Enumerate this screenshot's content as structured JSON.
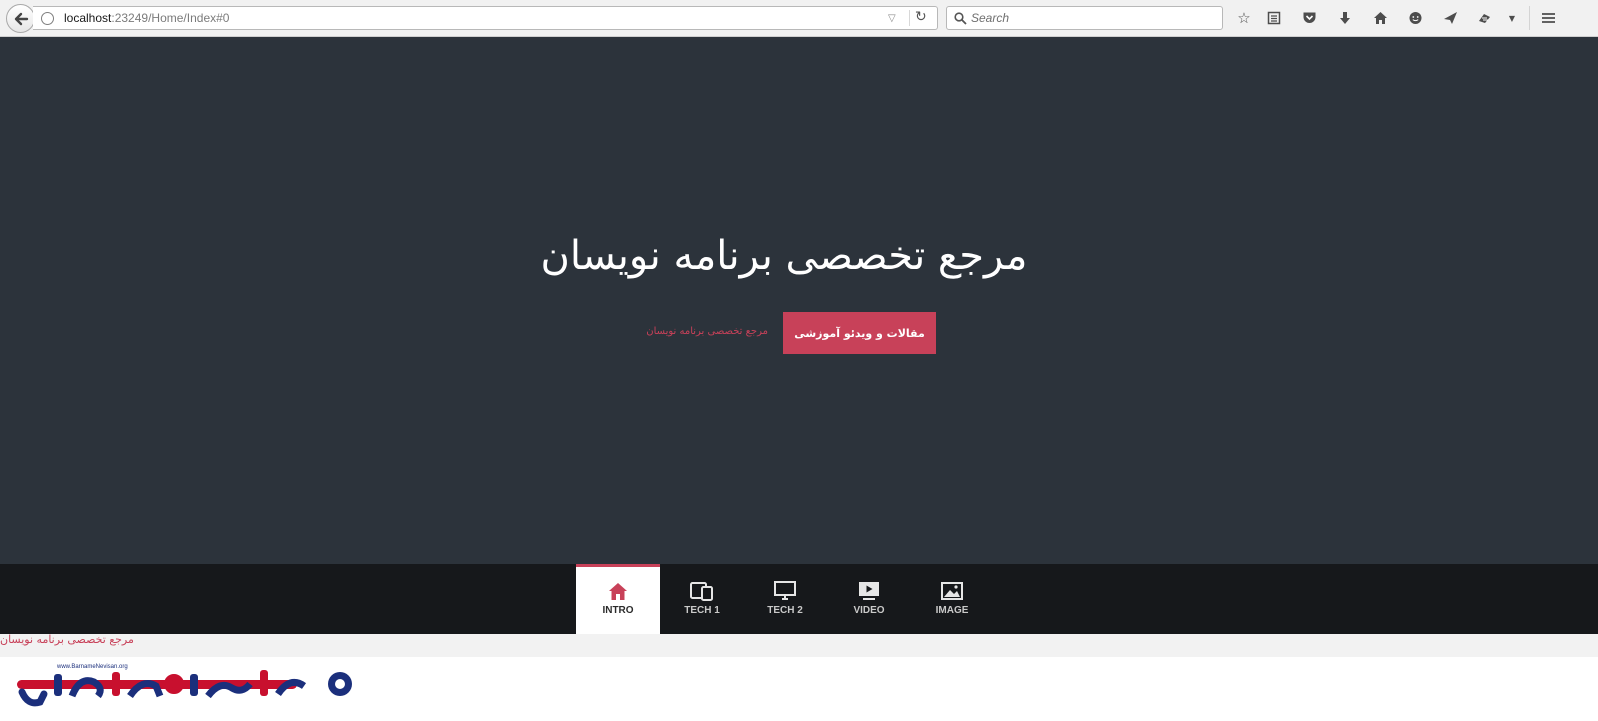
{
  "browser": {
    "url_host": "localhost",
    "url_rest": ":23249/Home/Index#0",
    "search_placeholder": "Search"
  },
  "hero": {
    "title": "مرجع تخصصی برنامه نویسان",
    "cta_label": "مقالات و ویدئو آموزشی",
    "link_text": "مرجع تخصصی برنامه نویسان"
  },
  "nav": {
    "items": [
      {
        "label": "INTRO",
        "icon": "home-icon",
        "active": true
      },
      {
        "label": "TECH 1",
        "icon": "devices-icon",
        "active": false
      },
      {
        "label": "TECH 2",
        "icon": "monitor-icon",
        "active": false
      },
      {
        "label": "VIDEO",
        "icon": "video-icon",
        "active": false
      },
      {
        "label": "IMAGE",
        "icon": "image-icon",
        "active": false
      }
    ]
  },
  "footer": {
    "text": "مرجع تخصصی برنامه نویسان",
    "logo_tagline": "www.BarnameNevisan.org"
  },
  "colors": {
    "hero_bg": "#2c333b",
    "nav_bg": "#16181b",
    "accent": "#c84159"
  }
}
